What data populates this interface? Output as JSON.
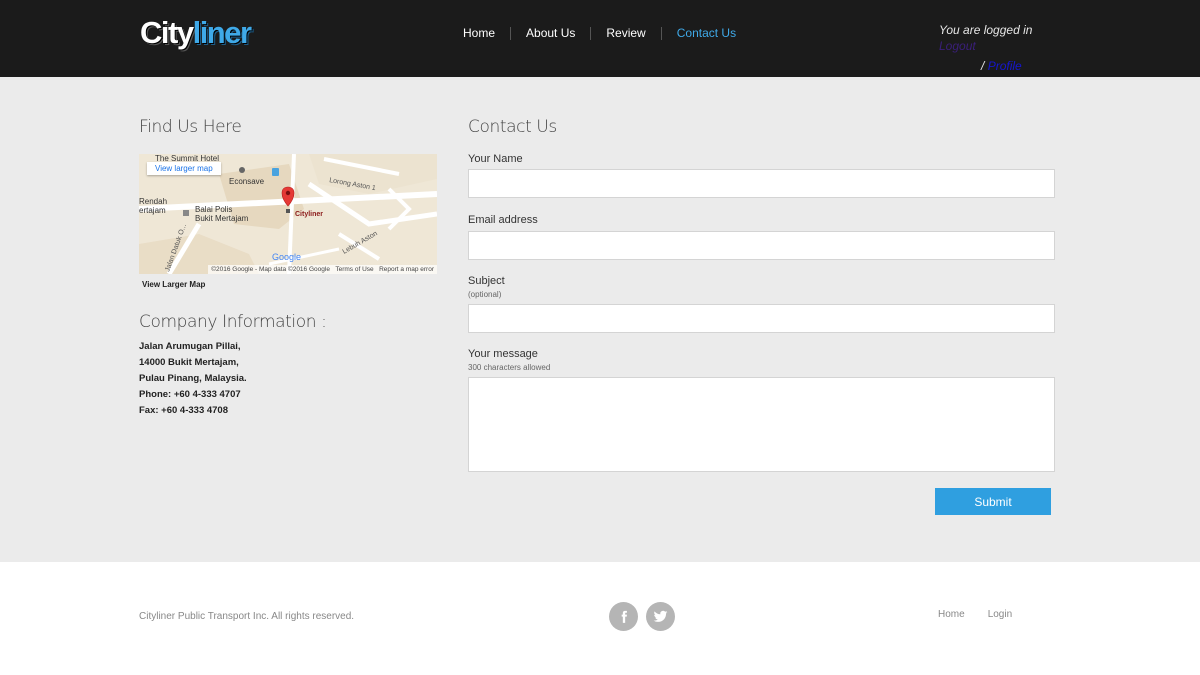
{
  "header": {
    "logo_part1": "City",
    "logo_part2": "liner",
    "nav": [
      {
        "label": "Home",
        "active": false
      },
      {
        "label": "About Us",
        "active": false
      },
      {
        "label": "Review",
        "active": false
      },
      {
        "label": "Contact Us",
        "active": true
      }
    ],
    "logged_in_text": "You are logged in",
    "logout_label": "Logout",
    "separator": "/",
    "profile_label": "Profile",
    "accent_color": "#3fa9e8"
  },
  "find_us": {
    "title": "Find Us Here",
    "map": {
      "view_larger_label": "View larger map",
      "places": [
        "The Summit Hotel",
        "Econsave",
        "Lorong Aston 1",
        "Rendah",
        "ertajam",
        "Balai Polis",
        "Bukit Mertajam",
        "Cityliner",
        "Lebuh Aston",
        "Jalan Datuk O..."
      ],
      "google": "Google",
      "copyright": "©2016 Google - Map data ©2016 Google",
      "terms": "Terms of Use",
      "report": "Report a map error"
    },
    "view_larger_map_label": "View Larger Map"
  },
  "company": {
    "title": "Company Information :",
    "lines": [
      "Jalan Arumugan Pillai,",
      "14000 Bukit Mertajam,",
      "Pulau Pinang, Malaysia.",
      "Phone: +60 4-333 4707",
      "Fax: +60 4-333 4708"
    ]
  },
  "contact": {
    "title": "Contact Us",
    "name_label": "Your Name",
    "name_value": "",
    "email_label": "Email address",
    "email_value": "",
    "subject_label": "Subject",
    "subject_hint": "(optional)",
    "subject_value": "",
    "message_label": "Your message",
    "message_hint": "300 characters allowed",
    "message_value": "",
    "submit_label": "Submit"
  },
  "footer": {
    "copyright": "Cityliner Public Transport Inc. All rights reserved.",
    "social_icons": [
      "facebook-icon",
      "twitter-icon"
    ],
    "links": [
      "Home",
      "Login"
    ]
  }
}
